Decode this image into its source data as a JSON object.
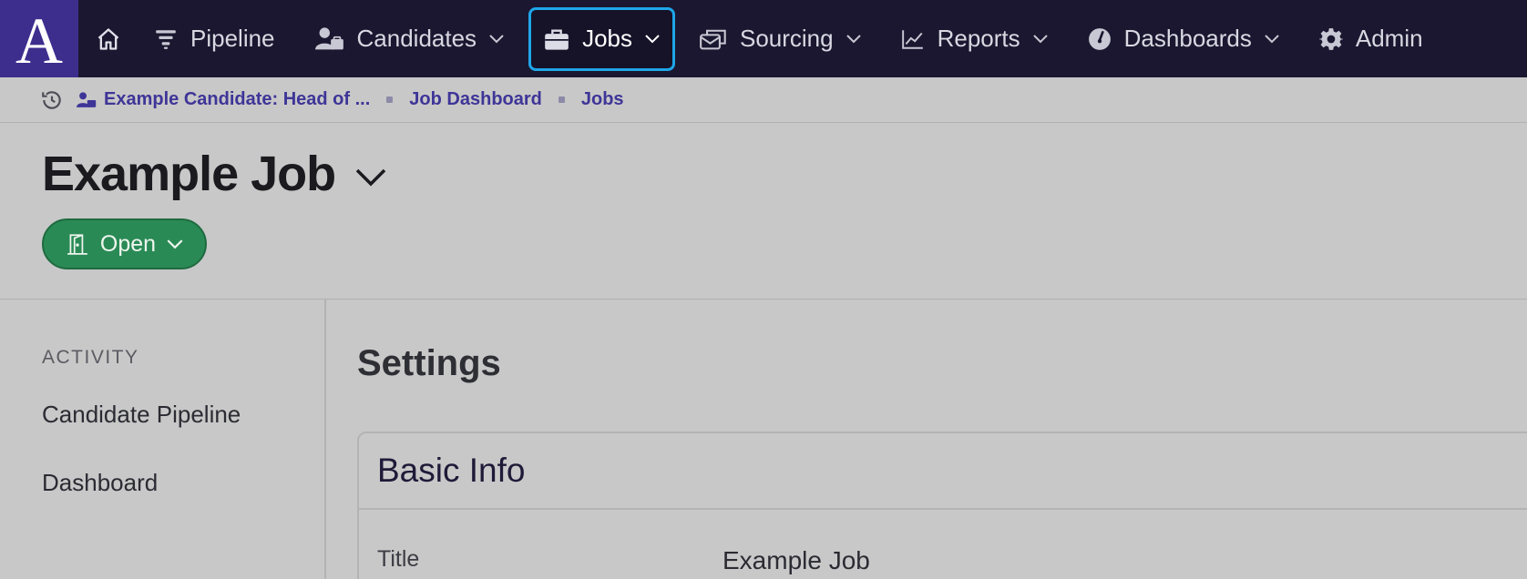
{
  "nav": {
    "logo": "A",
    "items": [
      {
        "label": "Pipeline",
        "icon": "funnel-icon",
        "has_dropdown": false
      },
      {
        "label": "Candidates",
        "icon": "candidates-icon",
        "has_dropdown": true
      },
      {
        "label": "Jobs",
        "icon": "briefcase-icon",
        "has_dropdown": true,
        "active": true
      },
      {
        "label": "Sourcing",
        "icon": "sourcing-icon",
        "has_dropdown": true
      },
      {
        "label": "Reports",
        "icon": "chart-line-icon",
        "has_dropdown": true
      },
      {
        "label": "Dashboards",
        "icon": "gauge-icon",
        "has_dropdown": true
      },
      {
        "label": "Admin",
        "icon": "gear-icon",
        "has_dropdown": false
      }
    ],
    "active_border_color": "#1fa6e8"
  },
  "breadcrumb": {
    "items": [
      "Example Candidate: Head of ...",
      "Job Dashboard",
      "Jobs"
    ]
  },
  "header": {
    "title": "Example Job",
    "status": "Open",
    "status_color": "#2a8a55"
  },
  "sidebar": {
    "section": "ACTIVITY",
    "links": [
      "Candidate Pipeline",
      "Dashboard"
    ]
  },
  "main": {
    "heading": "Settings",
    "card": {
      "title": "Basic Info",
      "fields": [
        {
          "label": "Title",
          "value": "Example Job"
        }
      ]
    }
  }
}
